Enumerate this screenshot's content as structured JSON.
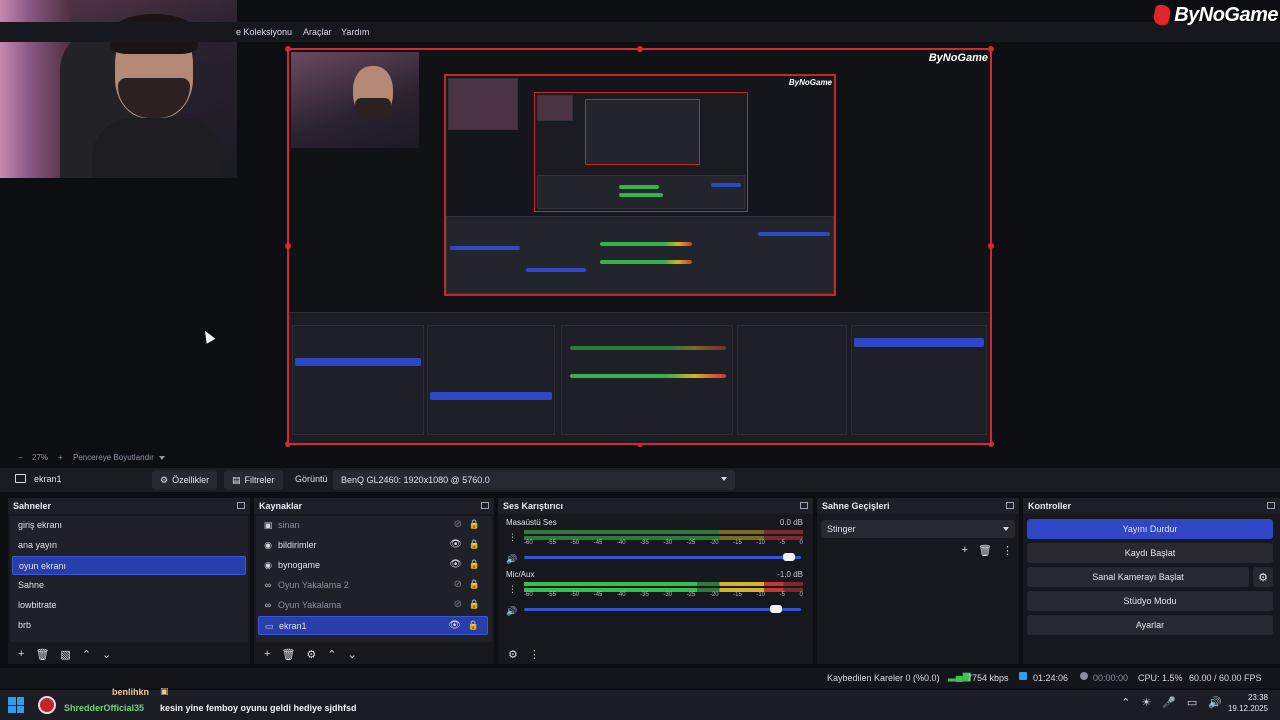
{
  "menu": {
    "items": [
      "e Koleksiyonu",
      "Araçlar",
      "Yardım"
    ]
  },
  "logo": {
    "text": "ByNoGame"
  },
  "zoom": {
    "minus": "−",
    "value": "27%",
    "plus": "+",
    "mode": "Pencereye Boyutlandır"
  },
  "toolbar": {
    "source_name": "ekran1",
    "properties_label": "Özellikler",
    "filters_label": "Filtreler",
    "display_label": "Görüntü",
    "display_value": "BenQ GL2460: 1920x1080 @ 5760.0"
  },
  "scenes": {
    "title": "Sahneler",
    "items": [
      "giriş ekranı",
      "ana yayın",
      "oyun ekranı",
      "Sahne",
      "lowbitrate",
      "brb"
    ],
    "selected_index": 2
  },
  "sources": {
    "title": "Kaynaklar",
    "items": [
      {
        "label": "sinan",
        "icon": "image-icon",
        "visible": false
      },
      {
        "label": "bildirimler",
        "icon": "browser-icon",
        "visible": true
      },
      {
        "label": "bynogame",
        "icon": "browser-icon",
        "visible": true
      },
      {
        "label": "Oyun Yakalama 2",
        "icon": "link-icon",
        "visible": false
      },
      {
        "label": "Oyun Yakalama",
        "icon": "link-icon",
        "visible": false
      },
      {
        "label": "ekran1",
        "icon": "monitor-icon",
        "visible": true
      }
    ],
    "selected_index": 5
  },
  "mixer": {
    "title": "Ses Karıştırıcı",
    "channels": [
      {
        "name": "Masaüstü Ses",
        "db": "0.0 dB",
        "level": 0.0,
        "fader": 0.98
      },
      {
        "name": "Mic/Aux",
        "db": "-1.0 dB",
        "level": 0.6,
        "fader": 0.93
      }
    ],
    "ticks": [
      "-60",
      "-55",
      "-50",
      "-45",
      "-40",
      "-35",
      "-30",
      "-25",
      "-20",
      "-15",
      "-10",
      "-5",
      "0"
    ]
  },
  "transitions": {
    "title": "Sahne Geçişleri",
    "value": "Stinger"
  },
  "controls": {
    "title": "Kontroller",
    "stop_stream": "Yayını Durdur",
    "start_record": "Kaydı Başlat",
    "start_vcam": "Sanal Kamerayı Başlat",
    "studio_mode": "Stüdyo Modu",
    "settings": "Ayarlar"
  },
  "status": {
    "dropped": "Kaybedilen Kareler 0 (%0.0)",
    "bitrate": "7754 kbps",
    "stream_time": "01:24:06",
    "rec_time": "00:00:00",
    "cpu": "CPU: 1.5%",
    "fps": "60.00 / 60.00 FPS"
  },
  "taskbar": {
    "chat_user": "benlihkn",
    "chat_name": "ShredderOfficial35",
    "chat_message": "kesin yine femboy oyunu geldi hediye sjdhfsd",
    "time": "23:38",
    "date": "19.12.2025"
  },
  "colors": {
    "accent": "#2f47c4",
    "selection": "#283ea8",
    "border_red": "#d9272e"
  }
}
